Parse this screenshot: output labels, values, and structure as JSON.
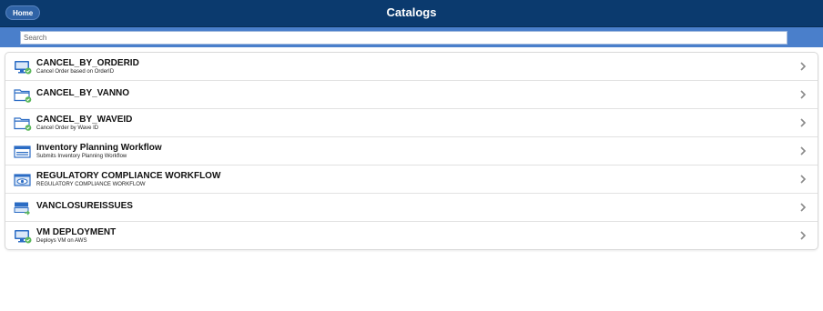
{
  "header": {
    "home_label": "Home",
    "title": "Catalogs"
  },
  "search": {
    "placeholder": "Search",
    "value": ""
  },
  "catalogs": [
    {
      "name": "CANCEL_BY_ORDERID",
      "description": "Cancel Order based on OrderID",
      "icon": "monitor-check-icon"
    },
    {
      "name": "CANCEL_BY_VANNO",
      "description": "",
      "icon": "folder-check-icon"
    },
    {
      "name": "CANCEL_BY_WAVEID",
      "description": "Cancel Order by Wave ID",
      "icon": "folder-check-icon"
    },
    {
      "name": "Inventory Planning Workflow",
      "description": "Submits Inventory Planning Workflow",
      "icon": "window-icon"
    },
    {
      "name": "REGULATORY COMPLIANCE WORKFLOW",
      "description": "REGULATORY COMPLIANCE WORKFLOW",
      "icon": "eye-window-icon"
    },
    {
      "name": "VANCLOSUREISSUES",
      "description": "",
      "icon": "server-arrow-icon"
    },
    {
      "name": "VM DEPLOYMENT",
      "description": "Deploys VM on AWS",
      "icon": "monitor-check-icon"
    }
  ],
  "colors": {
    "header": "#0b3a6e",
    "searchbar": "#4a7fcb",
    "icon_blue": "#2b6cc4",
    "icon_green": "#5cb85c"
  }
}
